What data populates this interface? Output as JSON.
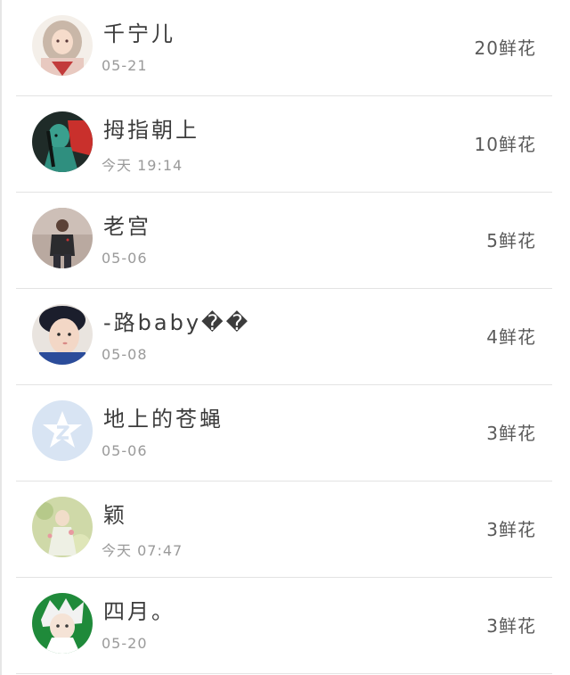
{
  "items": [
    {
      "name": "千宁儿",
      "time": "05-21",
      "flowers": "20鲜花",
      "avatar_icon": "anime-girl-avatar-icon"
    },
    {
      "name": "拇指朝上",
      "time": "今天 19:14",
      "flowers": "10鲜花",
      "avatar_icon": "dark-art-avatar-icon"
    },
    {
      "name": "老宫",
      "time": "05-06",
      "flowers": "5鲜花",
      "avatar_icon": "man-photo-avatar-icon"
    },
    {
      "name": "-路baby��",
      "time": "05-08",
      "flowers": "4鲜花",
      "avatar_icon": "child-photo-avatar-icon"
    },
    {
      "name": "地上的苍蝇",
      "time": "05-06",
      "flowers": "3鲜花",
      "avatar_icon": "default-star-avatar-icon"
    },
    {
      "name": "颖",
      "time": "今天 07:47",
      "flowers": "3鲜花",
      "avatar_icon": "painting-girl-avatar-icon"
    },
    {
      "name": "四月。",
      "time": "05-20",
      "flowers": "3鲜花",
      "avatar_icon": "white-hair-anime-avatar-icon"
    }
  ],
  "colors": {
    "divider": "#e3e3e3",
    "name_text": "#3c3c3c",
    "time_text": "#9a9a9a",
    "default_avatar_bg": "#d8e4f3"
  }
}
